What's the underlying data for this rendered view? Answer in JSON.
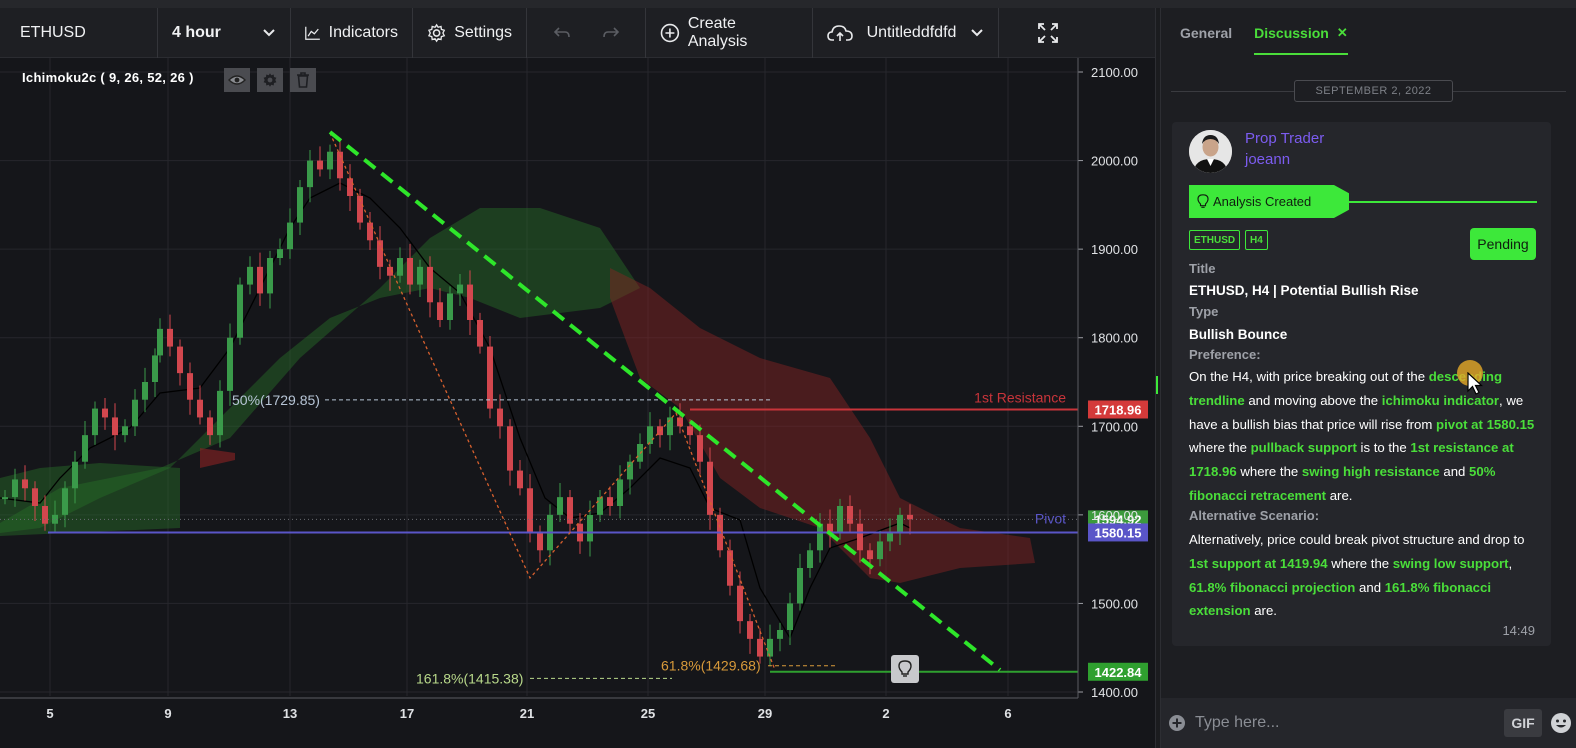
{
  "toolbar": {
    "symbol": "ETHUSD",
    "interval": "4 hour",
    "indicators_label": "Indicators",
    "settings_label": "Settings",
    "create_analysis_label": "Create Analysis",
    "layout_name": "Untitleddfdfd"
  },
  "indicator": {
    "label": "Ichimoku2c ( 9, 26, 52, 26 )"
  },
  "chart_data": {
    "type": "candlestick",
    "symbol": "ETHUSD",
    "interval": "4 hour",
    "y_ticks": [
      "2100.00",
      "2000.00",
      "1900.00",
      "1800.00",
      "1700.00",
      "1600.00",
      "1500.00",
      "1400.00"
    ],
    "ylim": [
      1400,
      2100
    ],
    "x_ticks": [
      "5",
      "9",
      "13",
      "17",
      "21",
      "25",
      "29",
      "2",
      "6"
    ],
    "price_labels": [
      {
        "text": "1718.96",
        "value": 1718.96,
        "color": "#d43a3a"
      },
      {
        "text": "1594.92",
        "value": 1594.92,
        "color": "#3c9a3c"
      },
      {
        "text": "1580.15",
        "value": 1580.15,
        "color": "#5a55c8"
      },
      {
        "text": "1422.84",
        "value": 1422.84,
        "color": "#2fa02f"
      }
    ],
    "annotations": {
      "resistance": "1st Resistance",
      "pivot": "Pivot",
      "fib50": "50%(1729.85)",
      "fib618": "61.8%(1429.68)",
      "fib1618": "161.8%(1415.38)"
    },
    "levels": {
      "resistance": 1718.96,
      "pivot": 1580.15,
      "support": 1422.84
    }
  },
  "panel": {
    "tab_general": "General",
    "tab_discussion": "Discussion",
    "date": "SEPTEMBER 2, 2022",
    "user_role": "Prop Trader",
    "user_name": "joeann",
    "banner": "Analysis Created",
    "tag_symbol": "ETHUSD",
    "tag_tf": "H4",
    "status": "Pending",
    "title_label": "Title",
    "title_value": "ETHUSD, H4 | Potential Bullish Rise",
    "type_label": "Type",
    "type_value": "Bullish Bounce",
    "pref_label": "Preference:",
    "pref_segments": [
      {
        "t": "On the H4, with price breaking out of the ",
        "g": false
      },
      {
        "t": "descending trendline",
        "g": true
      },
      {
        "t": " and moving above the ",
        "g": false
      },
      {
        "t": "ichimoku indicator",
        "g": true
      },
      {
        "t": ", we have a bullish bias that price will rise from ",
        "g": false
      },
      {
        "t": "pivot at 1580.15",
        "g": true
      },
      {
        "t": " where the ",
        "g": false
      },
      {
        "t": "pullback support",
        "g": true
      },
      {
        "t": " is to the ",
        "g": false
      },
      {
        "t": "1st resistance at 1718.96",
        "g": true
      },
      {
        "t": " where the ",
        "g": false
      },
      {
        "t": "swing high resistance",
        "g": true
      },
      {
        "t": " and ",
        "g": false
      },
      {
        "t": "50% fibonacci retracement",
        "g": true
      },
      {
        "t": " are.",
        "g": false
      }
    ],
    "alt_label": "Alternative Scenario:",
    "alt_segments": [
      {
        "t": "Alternatively, price could break pivot structure and drop to ",
        "g": false
      },
      {
        "t": "1st support at 1419.94",
        "g": true
      },
      {
        "t": " where the ",
        "g": false
      },
      {
        "t": "swing low support",
        "g": true
      },
      {
        "t": ", ",
        "g": false
      },
      {
        "t": "61.8% fibonacci projection",
        "g": true
      },
      {
        "t": " and ",
        "g": false
      },
      {
        "t": "161.8% fibonacci extension",
        "g": true
      },
      {
        "t": " are.",
        "g": false
      }
    ],
    "time": "14:49",
    "input_placeholder": "Type here...",
    "gif_label": "GIF"
  }
}
